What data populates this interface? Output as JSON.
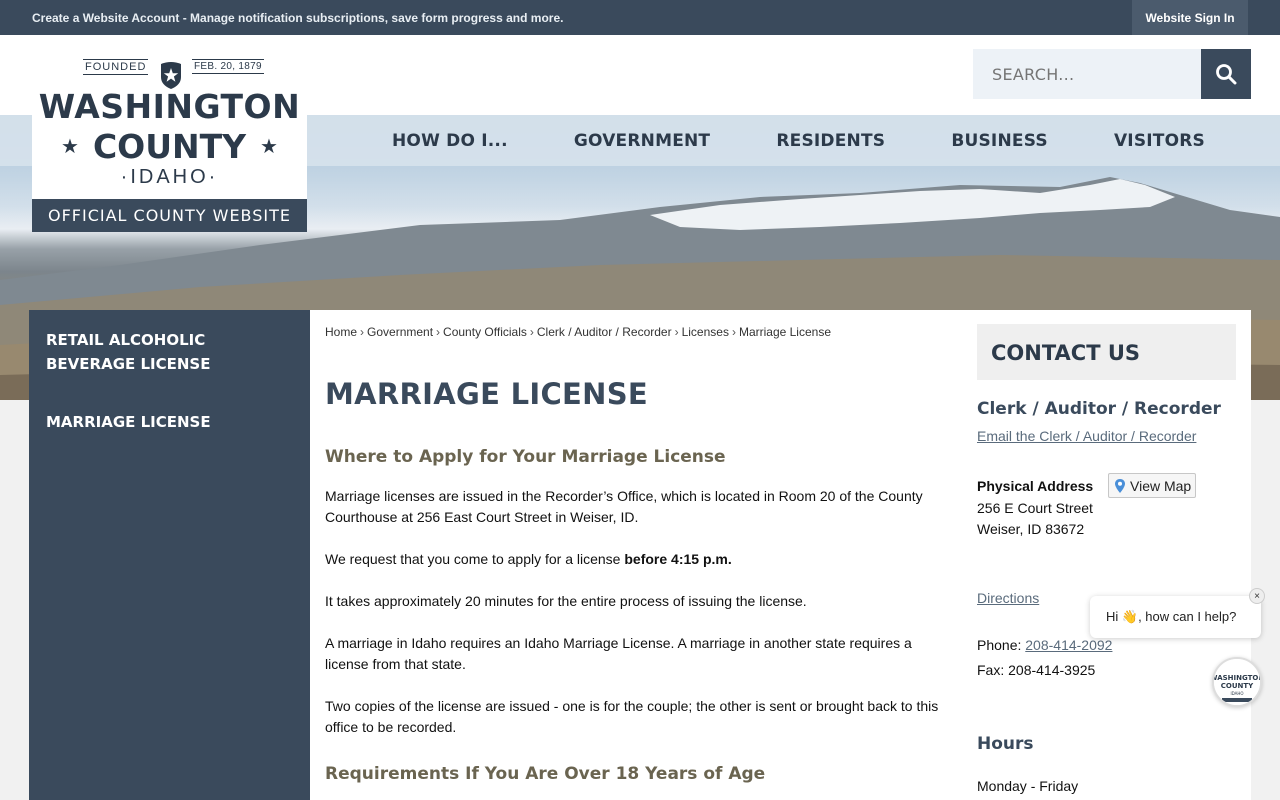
{
  "topbar": {
    "account_text": "Create a Website Account - Manage notification subscriptions, save form progress and more.",
    "signin_label": "Website Sign In"
  },
  "logo": {
    "founded": "FOUNDED",
    "date": "FEB. 20, 1879",
    "line1": "WASHINGTON",
    "line2": "COUNTY",
    "line3": "IDAHO",
    "tagline": "OFFICIAL COUNTY WEBSITE"
  },
  "search": {
    "placeholder": "SEARCH..."
  },
  "nav": [
    "HOW DO I...",
    "GOVERNMENT",
    "RESIDENTS",
    "BUSINESS",
    "VISITORS"
  ],
  "sidenav": {
    "items": [
      "RETAIL ALCOHOLIC BEVERAGE LICENSE",
      "MARRIAGE LICENSE"
    ]
  },
  "breadcrumb": [
    "Home",
    "Government",
    "County Officials",
    "Clerk / Auditor / Recorder",
    "Licenses",
    "Marriage License"
  ],
  "main": {
    "title": "MARRIAGE LICENSE",
    "heading1": "Where to Apply for Your Marriage License",
    "p1": "Marriage licenses are issued in the Recorder’s Office, which is located in Room 20 of the County Courthouse at 256 East Court Street in Weiser, ID.",
    "p2_before": "We request that you come to apply for a license ",
    "p2_bold": "before 4:15 p.m.",
    "p3": "It takes approximately 20 minutes for the entire process of issuing the license.",
    "p4": "A marriage in Idaho requires an Idaho Marriage License. A marriage in another state requires a license from that state.",
    "p5": "Two copies of the license are issued - one is for the couple; the other is sent or brought back to this office to be recorded.",
    "heading2": "Requirements If You Are Over 18 Years of Age"
  },
  "contact": {
    "title": "CONTACT US",
    "dept": "Clerk / Auditor / Recorder",
    "email_link": "Email the Clerk / Auditor / Recorder",
    "address_label": "Physical Address",
    "view_map": "View Map",
    "street": "256 E Court Street",
    "city": "Weiser, ID 83672",
    "directions": "Directions",
    "phone_label": "Phone: ",
    "phone": "208-414-2092",
    "fax": "Fax: 208-414-3925",
    "hours_title": "Hours",
    "hours_days": "Monday - Friday"
  },
  "chat": {
    "greeting": "Hi 👋, how can I help?",
    "close": "×",
    "avatar_line1": "WASHINGTON",
    "avatar_line2": "COUNTY",
    "avatar_line3": "IDAHO"
  }
}
